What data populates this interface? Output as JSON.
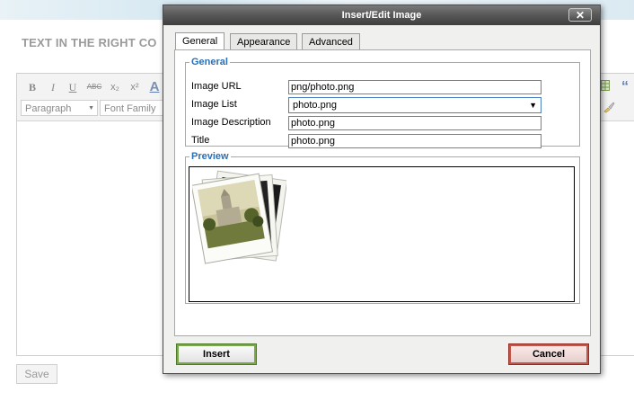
{
  "page": {
    "heading": "TEXT IN THE RIGHT CO",
    "save_label": "Save"
  },
  "editor": {
    "toolbar": {
      "bold": "B",
      "italic": "I",
      "underline": "U",
      "strikethrough": "ABC",
      "subscript": "x₂",
      "superscript": "x²",
      "font_color": "A",
      "quote": "“"
    },
    "format_select": "Paragraph",
    "font_family_select": "Font Family"
  },
  "dialog": {
    "title": "Insert/Edit Image",
    "close_label": "✕",
    "tabs": [
      {
        "label": "General",
        "active": true
      },
      {
        "label": "Appearance",
        "active": false
      },
      {
        "label": "Advanced",
        "active": false
      }
    ],
    "general_legend": "General",
    "fields": {
      "image_url": {
        "label": "Image URL",
        "value": "png/photo.png"
      },
      "image_list": {
        "label": "Image List",
        "value": "photo.png"
      },
      "image_description": {
        "label": "Image Description",
        "value": "photo.png"
      },
      "title": {
        "label": "Title",
        "value": "photo.png"
      }
    },
    "preview_legend": "Preview",
    "insert_label": "Insert",
    "cancel_label": "Cancel"
  },
  "colors": {
    "legend": "#2b6fb6",
    "titlebar": "#4a4a4a",
    "insert_border": "#7aa74a",
    "cancel_border": "#c4554a"
  },
  "icons": [
    "table-icon",
    "quote-icon",
    "cleanup-brush-icon",
    "close-icon",
    "dropdown-arrow-icon",
    "photo-preview-image"
  ]
}
